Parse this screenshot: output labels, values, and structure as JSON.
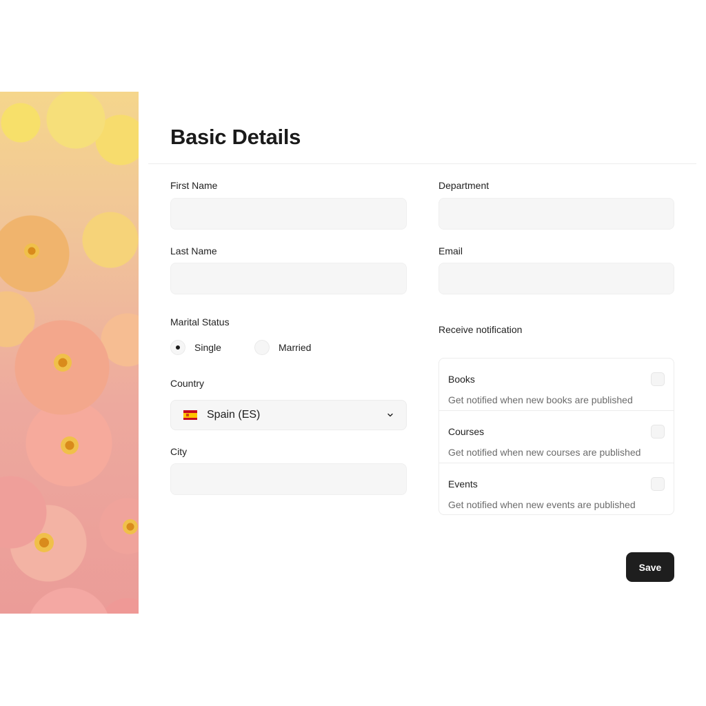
{
  "page": {
    "title": "Basic Details"
  },
  "form": {
    "first_name": {
      "label": "First Name",
      "value": "",
      "placeholder": ""
    },
    "last_name": {
      "label": "Last Name",
      "value": "",
      "placeholder": ""
    },
    "department": {
      "label": "Department",
      "value": "",
      "placeholder": ""
    },
    "email": {
      "label": "Email",
      "value": "",
      "placeholder": ""
    },
    "city": {
      "label": "City",
      "value": "",
      "placeholder": ""
    },
    "marital_status": {
      "label": "Marital Status",
      "options": [
        {
          "label": "Single",
          "selected": true
        },
        {
          "label": "Married",
          "selected": false
        }
      ]
    },
    "country": {
      "label": "Country",
      "selected": "Spain (ES)",
      "flag_icon": "spain-flag-icon"
    },
    "notifications": {
      "label": "Receive notification",
      "items": [
        {
          "title": "Books",
          "description": "Get notified when new books are published",
          "checked": false
        },
        {
          "title": "Courses",
          "description": "Get notified when new courses are published",
          "checked": false
        },
        {
          "title": "Events",
          "description": "Get notified when new events are published",
          "checked": false
        }
      ]
    },
    "save_label": "Save"
  },
  "colors": {
    "primary_button": "#1e1e1e",
    "field_background": "#f6f6f6",
    "border": "#ececec",
    "muted_text": "#6b6b6b"
  }
}
